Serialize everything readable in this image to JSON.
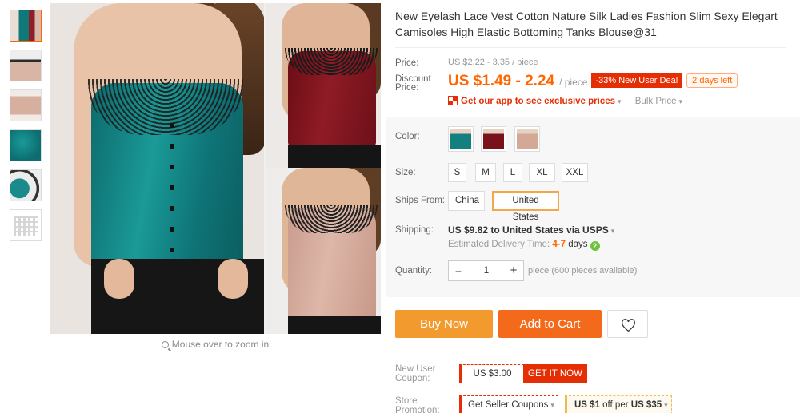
{
  "product": {
    "title": "New Eyelash Lace Vest Cotton Nature Silk Ladies Fashion Slim Sexy Elegart Camisoles High Elastic Bottoming Tanks Blouse@31"
  },
  "gallery": {
    "thumbnails": [
      "teal-red-pink-thumbnail",
      "pink-cami-back-thumbnail",
      "pink-cami-front-thumbnail",
      "teal-fabric-thumbnail",
      "lace-detail-thumbnail",
      "size-chart-thumbnail"
    ],
    "zoom_hint": "Mouse over to zoom in"
  },
  "pricing": {
    "price_label": "Price:",
    "original_price": "US $2.22 - 3.35 / piece",
    "discount_label_1": "Discount",
    "discount_label_2": "Price:",
    "discount_price": "US $1.49 - 2.24",
    "per_piece": "/ piece",
    "new_user_deal": "-33% New User Deal",
    "days_left": "2 days left",
    "app_link": "Get our app to see exclusive prices",
    "bulk_price": "Bulk Price"
  },
  "options": {
    "color_label": "Color:",
    "colors": [
      "teal",
      "wine-red",
      "pink"
    ],
    "size_label": "Size:",
    "sizes": [
      "S",
      "M",
      "L",
      "XL",
      "XXL"
    ],
    "ships_from_label": "Ships From:",
    "ships_from": [
      "China",
      "United States"
    ],
    "ships_from_selected": "United States"
  },
  "shipping": {
    "label": "Shipping:",
    "cost_text": "US $9.82 to United States via USPS",
    "delivery_prefix": "Estimated Delivery Time: ",
    "delivery_range": "4-7",
    "delivery_unit": " days"
  },
  "quantity": {
    "label": "Quantity:",
    "value": "1",
    "note": "piece (600 pieces available)"
  },
  "actions": {
    "buy_now": "Buy Now",
    "add_to_cart": "Add to Cart"
  },
  "coupons": {
    "new_user_label_1": "New User",
    "new_user_label_2": "Coupon:",
    "new_user_value": "US $3.00",
    "get_it_now": "GET IT NOW",
    "store_label_1": "Store",
    "store_label_2": "Promotion:",
    "seller_coupons": "Get Seller Coupons",
    "store_off_amount": "US $1",
    "store_off_mid": " off per ",
    "store_off_threshold": "US $35"
  },
  "colors": {
    "accent_orange": "#f60",
    "buy_now_bg": "#f39a2e",
    "add_to_cart_bg": "#f36a1a",
    "deal_red": "#e62e04"
  }
}
